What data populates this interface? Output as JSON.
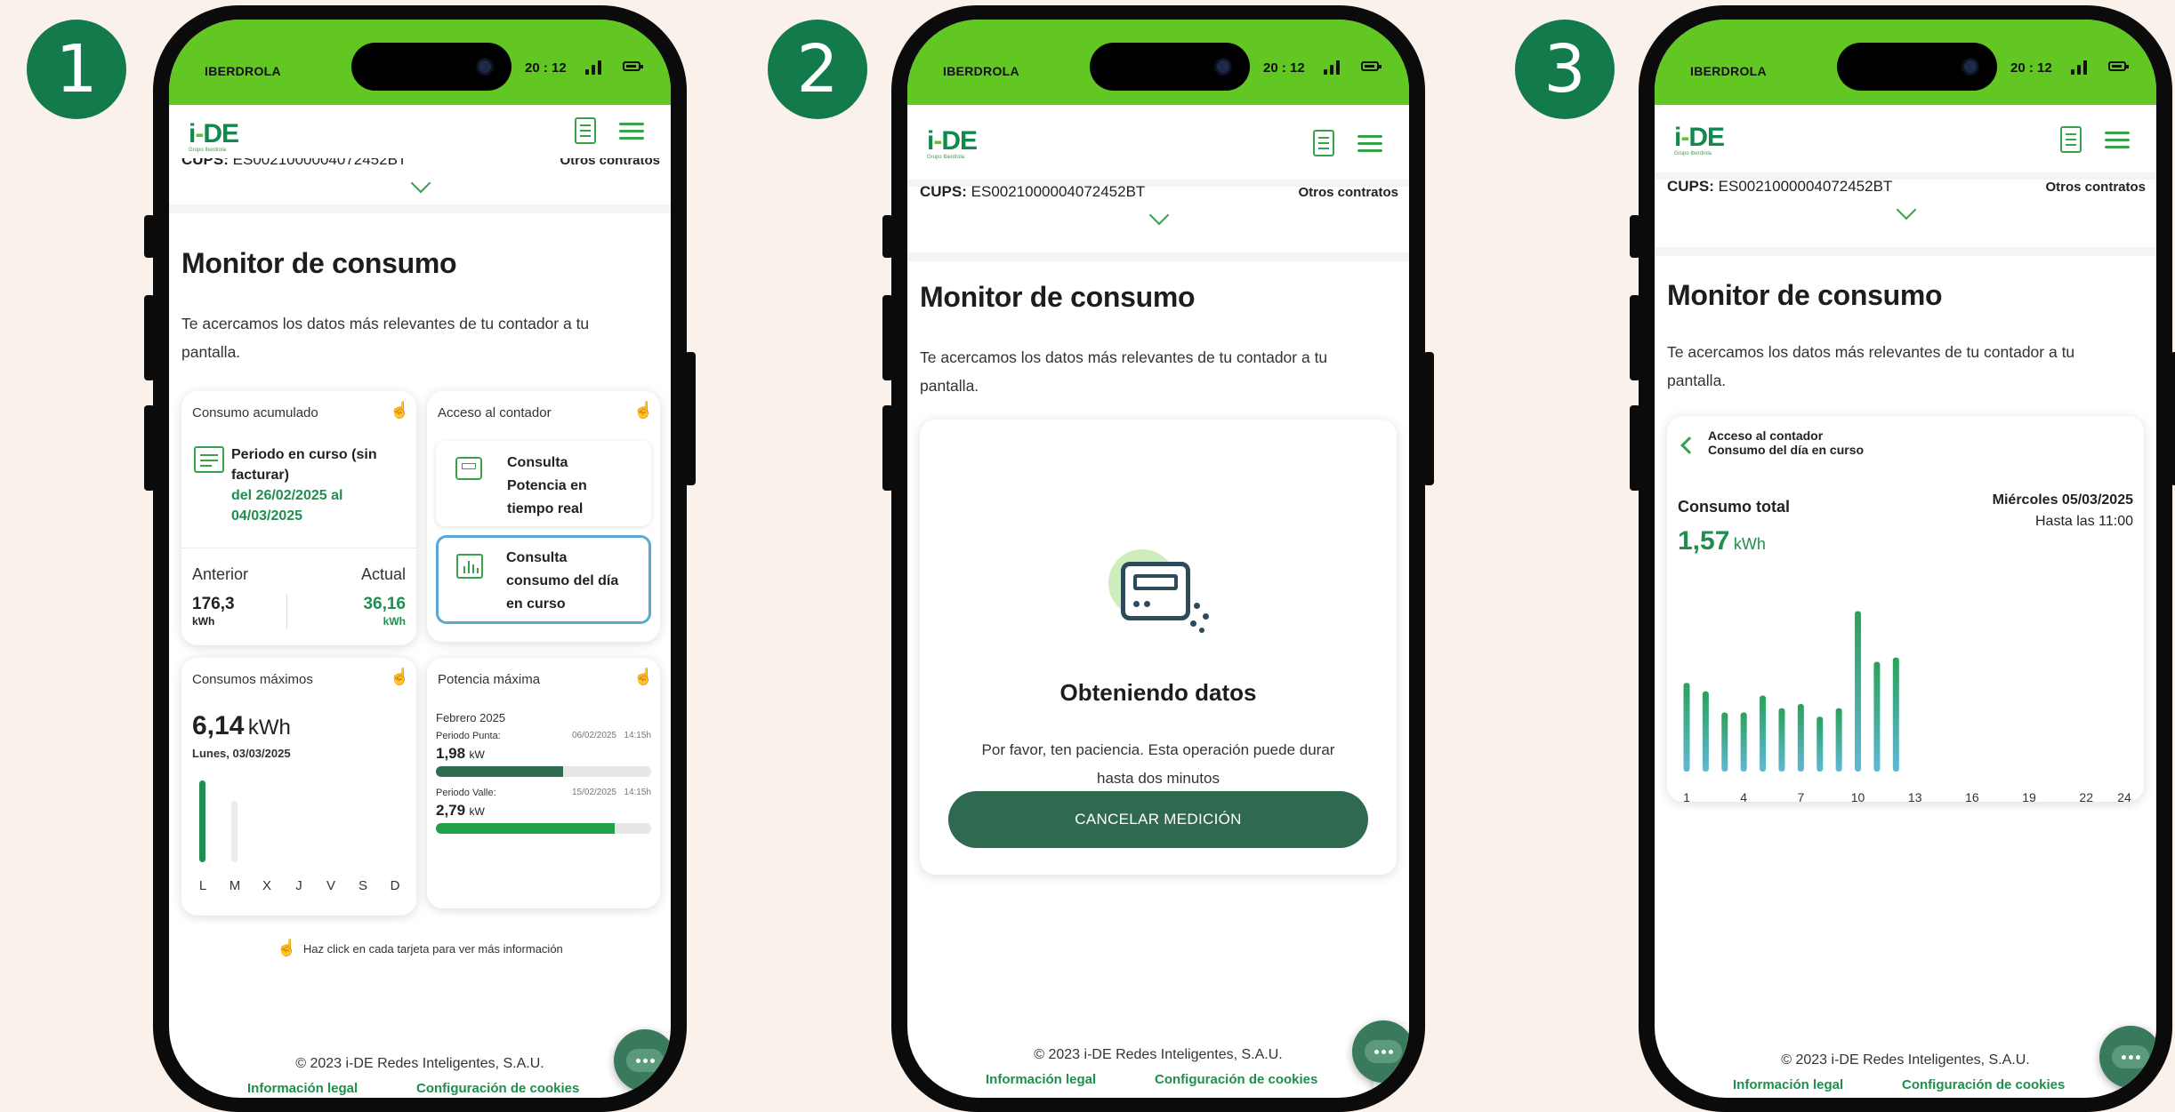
{
  "steps": [
    "1",
    "2",
    "3"
  ],
  "status_bar": {
    "carrier": "IBERDROLA",
    "time": "20 : 12"
  },
  "header": {
    "logo": "i-DE",
    "logo_sub": "Grupo Iberdrola"
  },
  "contract": {
    "cups_label": "CUPS:",
    "cups_value": "ES0021000004072452BT",
    "other_contracts": "Otros contratos"
  },
  "page": {
    "title": "Monitor de consumo",
    "intro_line1": "Te acercamos los datos más relevantes de tu contador a tu",
    "intro_line2": "pantalla."
  },
  "screen1": {
    "accumulated": {
      "title": "Consumo acumulado",
      "period_line1": "Periodo en curso (sin",
      "period_line2": "facturar)",
      "dates_line1": "del 26/02/2025 al",
      "dates_line2": "04/03/2025",
      "prev_label": "Anterior",
      "prev_value": "176,3",
      "prev_unit": "kWh",
      "curr_label": "Actual",
      "curr_value": "36,16",
      "curr_unit": "kWh"
    },
    "meter_access": {
      "title": "Acceso al contador",
      "option1_line1": "Consulta",
      "option1_line2": "Potencia en",
      "option1_line3": "tiempo real",
      "option2_line1": "Consulta",
      "option2_line2": "consumo del día",
      "option2_line3": "en curso"
    },
    "max_consumption": {
      "title": "Consumos máximos",
      "value": "6,14",
      "unit": "kWh",
      "date": "Lunes, 03/03/2025",
      "days": [
        "L",
        "M",
        "X",
        "J",
        "V",
        "S",
        "D"
      ],
      "bar_levels": [
        1.0,
        0.75
      ]
    },
    "max_power": {
      "title": "Potencia máxima",
      "month": "Febrero 2025",
      "peak_label": "Periodo Punta:",
      "peak_date": "06/02/2025",
      "peak_time": "14:15h",
      "peak_value": "1,98",
      "peak_unit": "kW",
      "peak_fill": 0.59,
      "valley_label": "Periodo Valle:",
      "valley_date": "15/02/2025",
      "valley_time": "14:15h",
      "valley_value": "2,79",
      "valley_unit": "kW",
      "valley_fill": 0.83
    },
    "hint": "Haz click en cada tarjeta para ver más información"
  },
  "screen2": {
    "loading_title": "Obteniendo datos",
    "loading_line1": "Por favor, ten paciencia. Esta operación puede durar",
    "loading_line2": "hasta dos minutos",
    "cancel_button": "CANCELAR MEDICIÓN"
  },
  "screen3": {
    "back_line1": "Acceso al contador",
    "back_line2": "Consumo del día en curso",
    "total_label": "Consumo total",
    "total_value": "1,57",
    "total_unit": "kWh",
    "date": "Miércoles 05/03/2025",
    "until": "Hasta las 11:00"
  },
  "chart_data": {
    "type": "bar",
    "x_ticks": [
      "1",
      "4",
      "7",
      "10",
      "13",
      "16",
      "19",
      "22",
      "24"
    ],
    "hours": [
      1,
      2,
      3,
      4,
      5,
      6,
      7,
      8,
      9,
      10,
      11,
      12
    ],
    "values": [
      0.105,
      0.095,
      0.07,
      0.07,
      0.09,
      0.075,
      0.08,
      0.065,
      0.075,
      0.19,
      0.13,
      0.135
    ],
    "ylabel": "",
    "xlabel": "",
    "colors": [
      "#2aa15a",
      "#5fb8d8"
    ]
  },
  "footer": {
    "copyright": "© 2023 i-DE Redes Inteligentes, S.A.U.",
    "legal": "Información legal",
    "cookies": "Configuración de cookies"
  },
  "colors": {
    "brand_green": "#62c623",
    "dark_green": "#137a4c",
    "button_green": "#2f6a50",
    "highlight_blue": "#5aa9d4"
  }
}
